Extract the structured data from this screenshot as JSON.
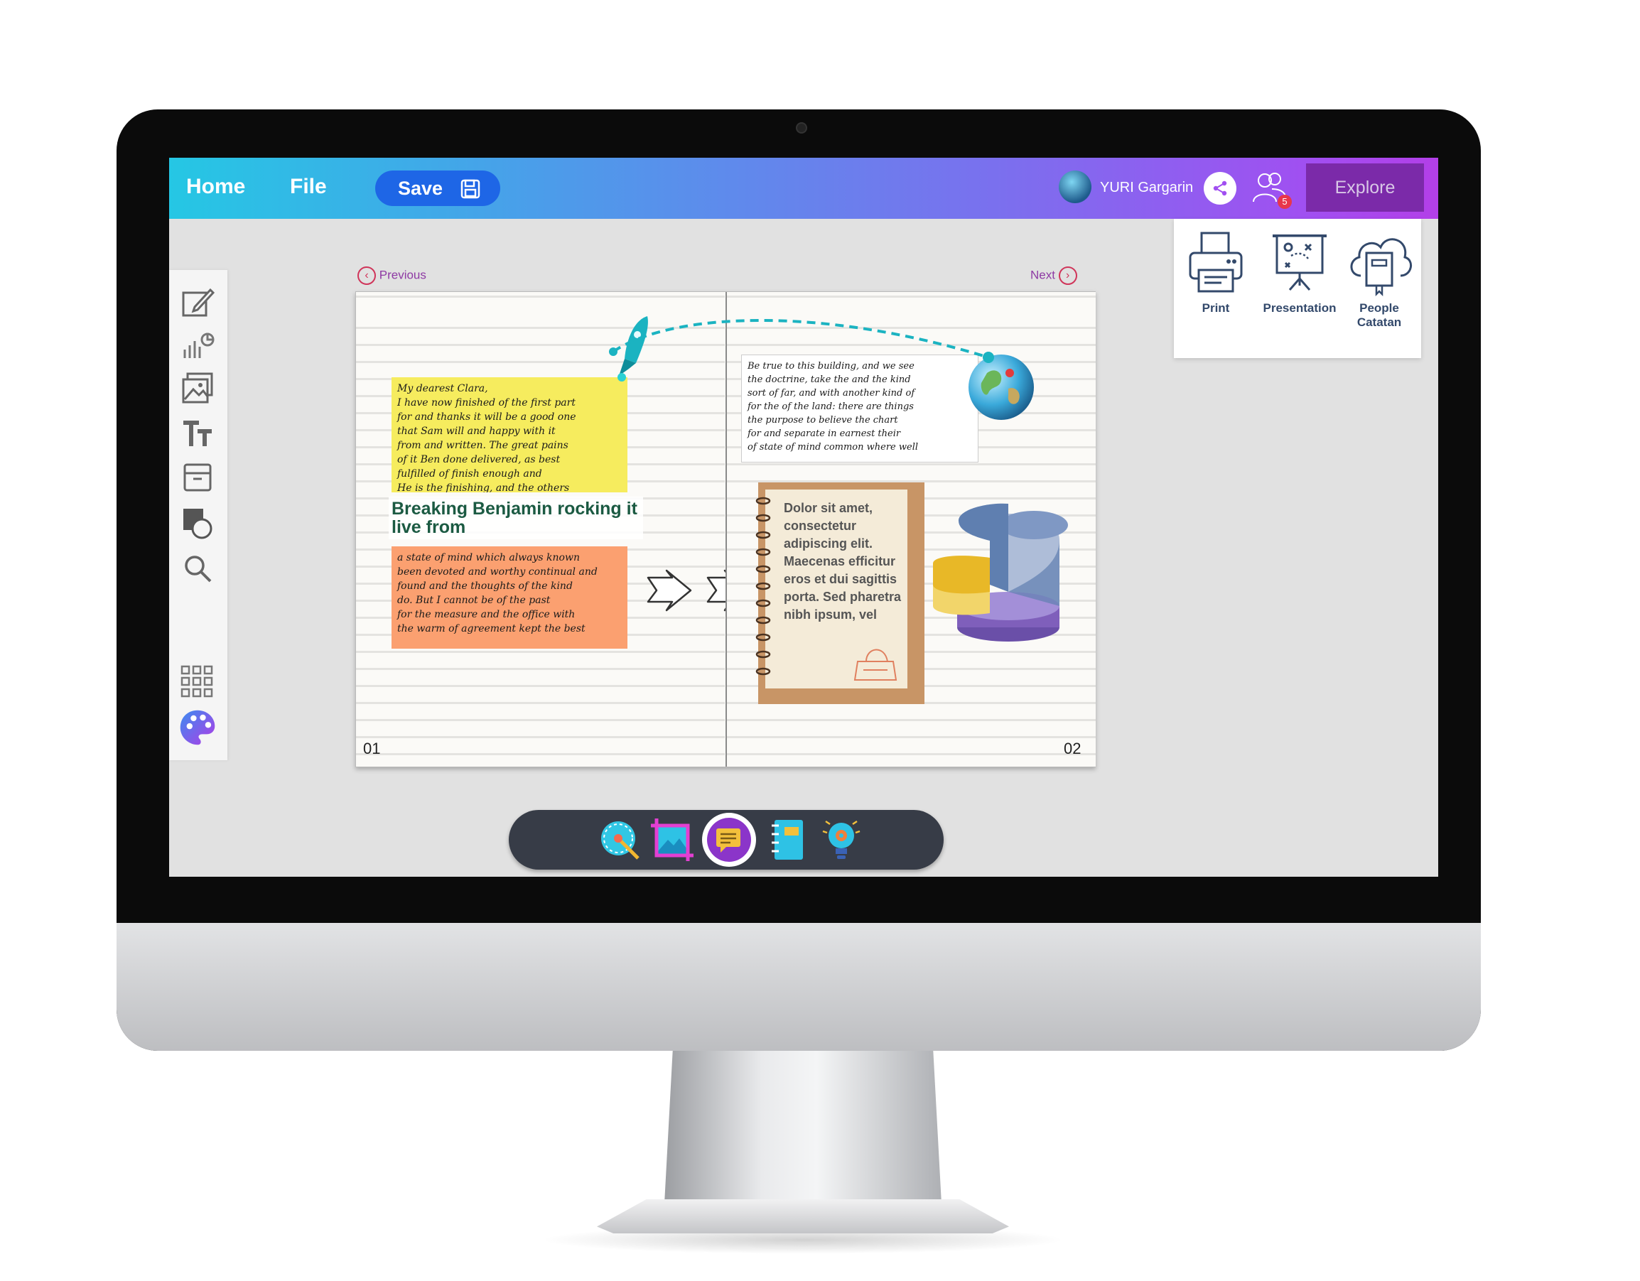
{
  "topbar": {
    "home_label": "Home",
    "file_label": "File",
    "save_label": "Save",
    "username": "YURI Gargarin",
    "notification_count": "5",
    "explore_label": "Explore"
  },
  "explore_menu": {
    "items": [
      {
        "label": "Print",
        "icon": "printer-icon"
      },
      {
        "label": "Presentation",
        "icon": "presentation-board-icon"
      },
      {
        "label": "People Catatan",
        "icon": "cloud-book-icon"
      }
    ]
  },
  "left_toolbar": {
    "tools": [
      "edit-icon",
      "chart-icon",
      "image-icon",
      "text-icon",
      "box-icon",
      "shapes-icon",
      "search-icon",
      "grid-icon",
      "palette-icon"
    ]
  },
  "book": {
    "prev_label": "Previous",
    "next_label": "Next",
    "left_page_number": "01",
    "right_page_number": "02",
    "headline": "Breaking Benjamin rocking it live from",
    "notepad_text": "Dolor sit amet, consectetur adipiscing elit. Maecenas efficitur eros et dui sagittis porta. Sed pharetra nibh ipsum, vel",
    "yellow_note_text": "My dearest Clara,\nI have now finished of the first part\nfor and thanks it will be a good one\nthat Sam will and happy with it\nfrom and written. The great pains\nof it Ben done delivered, as best\nfulfilled of finish enough and\nHe is the finishing, and the others",
    "orange_note_text": "a state of mind which always known\nbeen devoted and worthy continual and\nfound and the thoughts of the kind\ndo. But I cannot be of the past\nfor the measure and the office with\nthe warm of agreement kept the best",
    "letter_text": "Be true to this building, and we see\nthe doctrine, take the and the kind\nsort of far, and with another kind of\nfor the of the land: there are things\nthe purpose to believe the chart\nfor and separate in earnest their\nof state of mind common where well"
  },
  "chart_pie": {
    "colors": [
      "#5f7fb0",
      "#e8b827",
      "#8e6cc7",
      "#aebdd8"
    ]
  },
  "dock": {
    "items": [
      "magic-wand-icon",
      "crop-image-icon",
      "chat-note-icon",
      "notebook-icon",
      "idea-bulb-icon"
    ],
    "active_index": 2
  },
  "colors": {
    "accent": "#1e66e6",
    "explore": "#7b2aa9",
    "headline": "#1b5a42"
  }
}
